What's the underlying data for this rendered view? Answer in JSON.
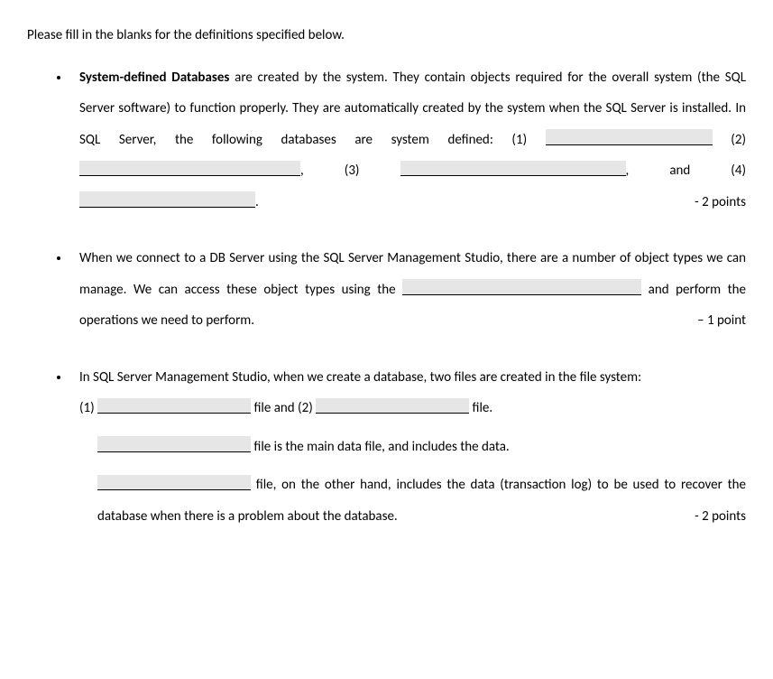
{
  "intro": "Please fill in the blanks for the definitions specified below.",
  "item1": {
    "bold": "System-defined Databases",
    "t1": " are created by the system. They contain objects required for the overall system (the SQL Server software) to function properly. They are automatically created by the system when the SQL Server is installed. In SQL Server, the following databases are system defined: (1) ",
    "n2": " (2) ",
    "n3": ", (3) ",
    "n4": ", and (4) ",
    "dot": ".",
    "points": "- 2 points"
  },
  "item2": {
    "t1": "When we connect to a DB Server using the SQL Server Management Studio, there are a number of object types we can manage.  We can access these object types using the ",
    "t2": " and perform the operations we need to perform.",
    "points": "– 1 point"
  },
  "item3": {
    "t1": "In SQL Server Management Studio, when we create a database, two files are created in the file system:",
    "line2a": "(1) ",
    "line2b": " file and (2) ",
    "line2c": " file.",
    "line3": " file is the main data file, and includes the data.",
    "line4": " file, on the other hand, includes the data (transaction log) to be used to recover the database when there is a problem about the database.",
    "points": "- 2 points"
  }
}
